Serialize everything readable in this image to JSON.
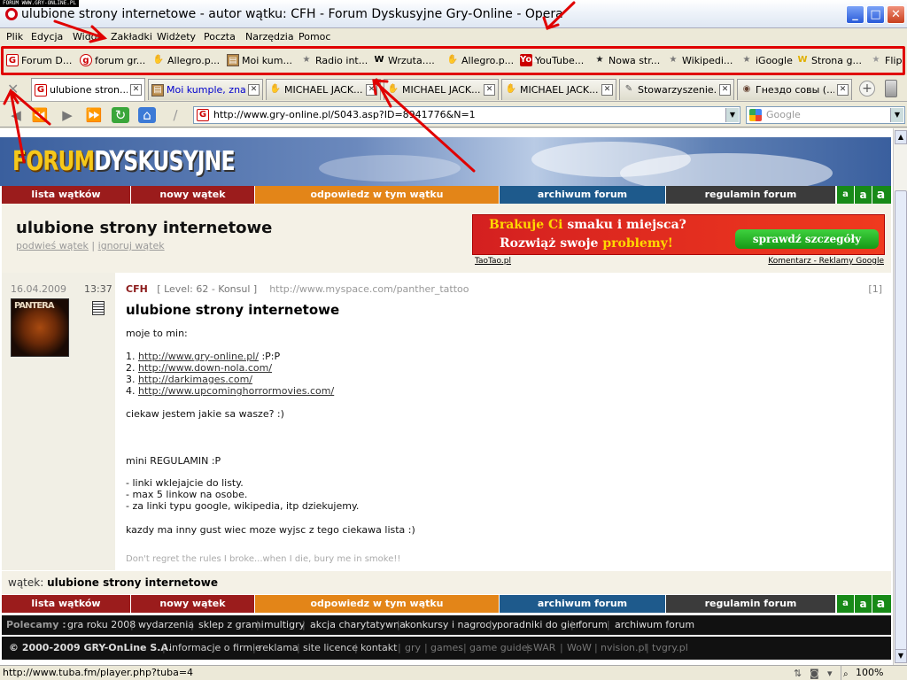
{
  "watermark": "FORUM WWW.GRY-ONLINE.PL",
  "window": {
    "title": "ulubione strony internetowe - autor wątku: CFH - Forum Dyskusyjne Gry-Online - Opera",
    "minimize": "_",
    "maximize": "□",
    "close": "✕"
  },
  "menu": [
    "Plik",
    "Edycja",
    "Widok",
    "Zakładki",
    "Widżety",
    "Poczta",
    "Narzędzia",
    "Pomoc"
  ],
  "bookmarks": [
    {
      "label": "Forum D...",
      "icon": "gry-online-icon"
    },
    {
      "label": "forum gr...",
      "icon": "gry-circle-icon"
    },
    {
      "label": "Allegro.p...",
      "icon": "hand-icon"
    },
    {
      "label": "Moi kum...",
      "icon": "moi-kumple-icon"
    },
    {
      "label": "Radio int...",
      "icon": "star-icon"
    },
    {
      "label": "Wrzuta....",
      "icon": "wrzuta-icon"
    },
    {
      "label": "Allegro.p...",
      "icon": "hand-icon"
    },
    {
      "label": "YouTube...",
      "icon": "youtube-icon"
    },
    {
      "label": "Nowa str...",
      "icon": "star-dark-icon"
    },
    {
      "label": "Wikipedi...",
      "icon": "star-icon"
    },
    {
      "label": "iGoogle",
      "icon": "star-icon"
    },
    {
      "label": "Strona g...",
      "icon": "yellow-w-icon"
    },
    {
      "label": "Flip",
      "icon": "star-icon"
    }
  ],
  "tabs": [
    {
      "label": "ulubione stron...",
      "icon": "gry-online-icon",
      "active": true
    },
    {
      "label": "Moi kumple, zna...",
      "icon": "moi-kumple-icon",
      "active": false
    },
    {
      "label": "MICHAEL JACK...",
      "icon": "hand-icon",
      "active": false
    },
    {
      "label": "MICHAEL JACK...",
      "icon": "hand-icon",
      "active": false
    },
    {
      "label": "MICHAEL JACK...",
      "icon": "hand-icon",
      "active": false
    },
    {
      "label": "Stowarzyszenie...",
      "icon": "feather-icon",
      "active": false
    },
    {
      "label": "Гнездо совы (...",
      "icon": "owl-icon",
      "active": false
    }
  ],
  "address": {
    "url": "http://www.gry-online.pl/S043.asp?ID=8941776&N=1",
    "search_placeholder": "Google"
  },
  "site": {
    "logo_part1": "FORUM",
    "logo_part2": "DYSKUSYJNE",
    "nav": [
      "lista wątków",
      "nowy wątek",
      "odpowiedz w tym wątku",
      "archiwum forum",
      "regulamin forum"
    ],
    "font_sizes": [
      "a",
      "a",
      "a"
    ],
    "thread_title": "ulubione strony internetowe",
    "action_follow": "podwieś wątek",
    "action_ignore": "ignoruj wątek",
    "ad": {
      "line1_a": "Brakuje Ci",
      "line1_b": "smaku i miejsca?",
      "line2_a": "Rozwiąż swoje",
      "line2_b": "problemy!",
      "button": "sprawdź szczegóły",
      "source": "TaoTao.pl",
      "google": "Komentarz - Reklamy Google"
    }
  },
  "post": {
    "date": "16.04.2009",
    "time": "13:37",
    "avatar_text": "PANTERA",
    "author": "CFH",
    "level": "[ Level: 62 - Konsul ]",
    "author_url": "http://www.myspace.com/panther_tattoo",
    "number": "[1]",
    "title": "ulubione strony internetowe",
    "intro": "moje to min:",
    "links": [
      {
        "n": "1.",
        "url": "http://www.gry-online.pl/",
        "suffix": " :P:P"
      },
      {
        "n": "2.",
        "url": "http://www.down-nola.com/",
        "suffix": ""
      },
      {
        "n": "3.",
        "url": "http://darkimages.com/",
        "suffix": ""
      },
      {
        "n": "4.",
        "url": "http://www.upcominghorrormovies.com/",
        "suffix": ""
      }
    ],
    "question": "ciekaw jestem jakie sa wasze? :)",
    "rules_title": "mini REGULAMIN :P",
    "rules": [
      "- linki wklejajcie do listy.",
      "- max 5 linkow na osobe.",
      "- za linki typu google, wikipedia, itp dziekujemy."
    ],
    "closing": "kazdy ma inny gust wiec moze wyjsc z tego ciekawa lista :)",
    "signature": "Don't regret the rules I broke...when I die, bury me in smoke!!"
  },
  "thread_footer": {
    "label": "wątek:",
    "title": "ulubione strony internetowe"
  },
  "footer": {
    "polecamy_label": "Polecamy :",
    "polecamy": [
      "gra roku 2008",
      "wydarzenia",
      "sklep z grami",
      "multigry",
      "akcja charytatywna",
      "konkursy i nagrody",
      "poradniki do gier",
      "forum",
      "archiwum forum"
    ],
    "copyright": "© 2000-2009 GRY-OnLine S.A.",
    "links2": [
      "informacje o firmie",
      "reklama",
      "site licence",
      "kontakt"
    ],
    "links3": [
      "gry",
      "games",
      "game guides",
      "WAR",
      "WoW",
      "nvision.pl",
      "tvgry.pl"
    ]
  },
  "status": {
    "text": "http://www.tuba.fm/player.php?tuba=4",
    "zoom": "100%"
  },
  "colors": {
    "annotation_red": "#e00000",
    "nav_red": "#9b1c1c",
    "nav_orange": "#e38518",
    "nav_blue": "#1e5a8c",
    "nav_dark": "#3b3b3b",
    "nav_green": "#178a17"
  }
}
